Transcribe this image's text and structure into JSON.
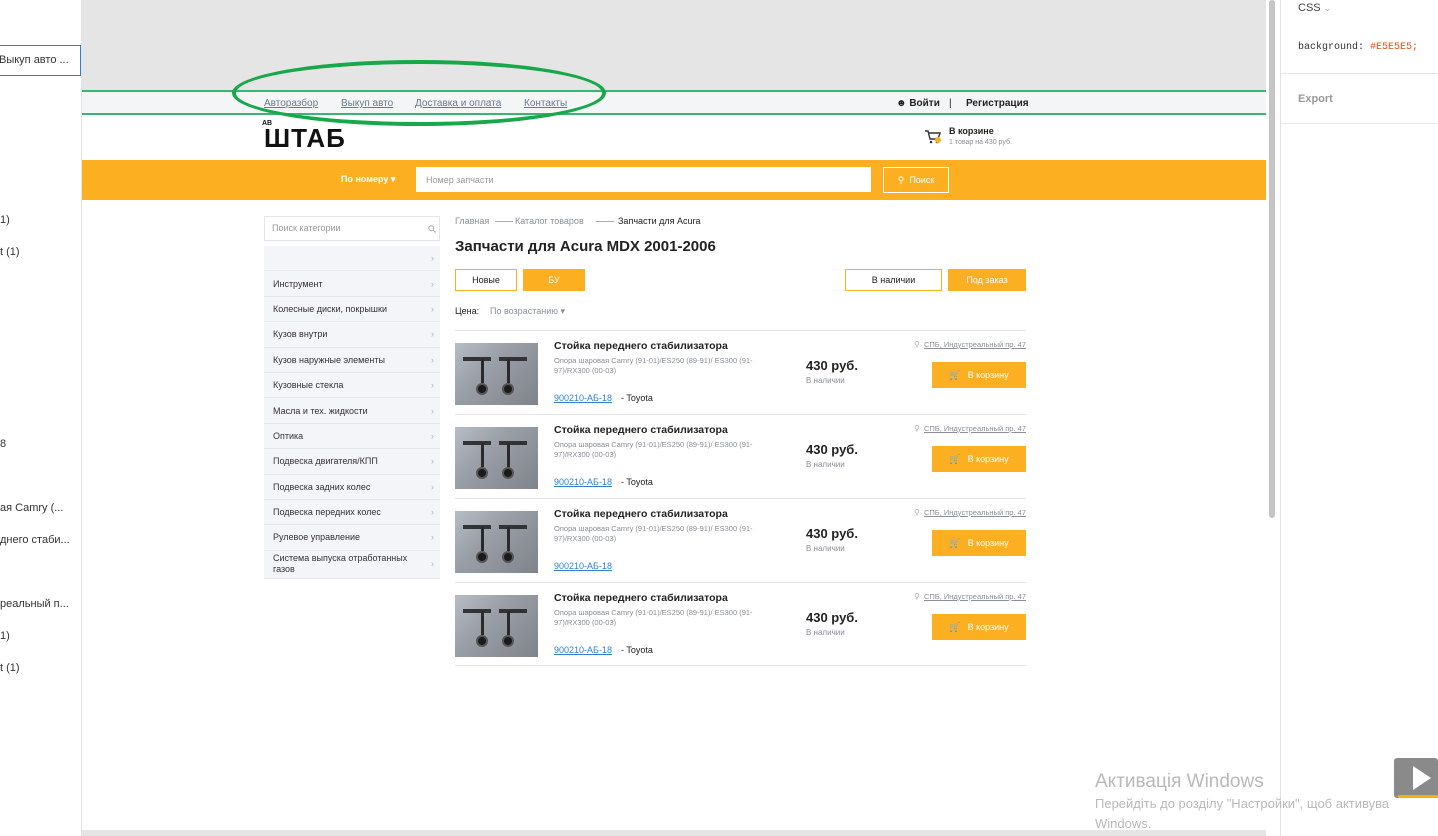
{
  "left_panel": {
    "layers": [
      {
        "text": "Выкуп авто ..."
      },
      {
        "text": "1)"
      },
      {
        "text": "t (1)"
      },
      {
        "text": "8"
      },
      {
        "text": "ая Camry (..."
      },
      {
        "text": "днего стаби..."
      },
      {
        "text": "реальный п..."
      },
      {
        "text": "1)"
      },
      {
        "text": "t (1)"
      }
    ]
  },
  "site": {
    "top_nav": [
      "Авторазбор",
      "Выкуп авто",
      "Доставка и оплата",
      "Контакты"
    ],
    "login": "Войти",
    "divider": "|",
    "register": "Регистрация",
    "logo_small": "АВ",
    "logo": "ШТАБ",
    "cart": {
      "title": "В корзине",
      "subtitle": "1 товар на 430 руб."
    },
    "search": {
      "mode": "По номеру",
      "placeholder": "Номер запчасти",
      "button": "Поиск"
    },
    "sidebar": {
      "search_placeholder": "Поиск категории",
      "categories": [
        "",
        "Инструмент",
        "Колесные диски, покрышки",
        "Кузов внутри",
        "Кузов наружные элементы",
        "Кузовные стекла",
        "Масла и тех. жидкости",
        "Оптика",
        "Подвеска двигателя/КПП",
        "Подвеска задних колес",
        "Подвеска передних колес",
        "Рулевое управление",
        "Система выпуска отработанных газов"
      ]
    },
    "breadcrumb": [
      "Главная",
      "Каталог товаров",
      "Запчасти для Acura"
    ],
    "page_title": "Запчасти для Acura MDX 2001-2006",
    "filters": {
      "new": "Новые",
      "used": "БУ",
      "in_stock": "В наличии",
      "order": "Под заказ"
    },
    "price_label": "Цена:",
    "price_sort": "По возрастанию",
    "products": [
      {
        "title": "Стойка переднего стабилизатора",
        "desc": "Опора шаровая Camry (91-01)/ES250 (89-91)/ ES300 (91-97)/RX300 (00-03)",
        "code": "900210-АБ-18",
        "brand": "- Toyota",
        "price": "430 руб.",
        "stock": "В наличии",
        "location": "СПБ, Индустреальный пр. 47",
        "cart_button": "В корзину"
      },
      {
        "title": "Стойка переднего стабилизатора",
        "desc": "Опора шаровая Camry (91-01)/ES250 (89-91)/ ES300 (91-97)/RX300 (00-03)",
        "code": "900210-АБ-18",
        "brand": "- Toyota",
        "price": "430 руб.",
        "stock": "В наличии",
        "location": "СПБ, Индустреальный пр. 47",
        "cart_button": "В корзину"
      },
      {
        "title": "Стойка переднего стабилизатора",
        "desc": "Опора шаровая Camry (91-01)/ES250 (89-91)/ ES300 (91-97)/RX300 (00-03)",
        "code": "900210-АБ-18",
        "brand": "",
        "price": "430 руб.",
        "stock": "В наличии",
        "location": "СПБ, Индустреальный пр. 47",
        "cart_button": "В корзину"
      },
      {
        "title": "Стойка переднего стабилизатора",
        "desc": "Опора шаровая Camry (91-01)/ES250 (89-91)/ ES300 (91-97)/RX300 (00-03)",
        "code": "900210-АБ-18",
        "brand": "- Toyota",
        "price": "430 руб.",
        "stock": "В наличии",
        "location": "СПБ, Индустреальный пр. 47",
        "cart_button": "В корзину"
      }
    ]
  },
  "right_panel": {
    "header": "CSS",
    "code_property": "background:",
    "code_value": "#E5E5E5;",
    "export": "Export"
  },
  "watermark": {
    "title": "Активація Windows",
    "line1": "Перейдіть до розділу \"Настройки\", щоб активува",
    "line2": "Windows."
  },
  "colors": {
    "accent": "#fdaf22",
    "link": "#2f7fd6",
    "highlight": "#17a84a",
    "canvas_bg": "#e5e5e5"
  }
}
